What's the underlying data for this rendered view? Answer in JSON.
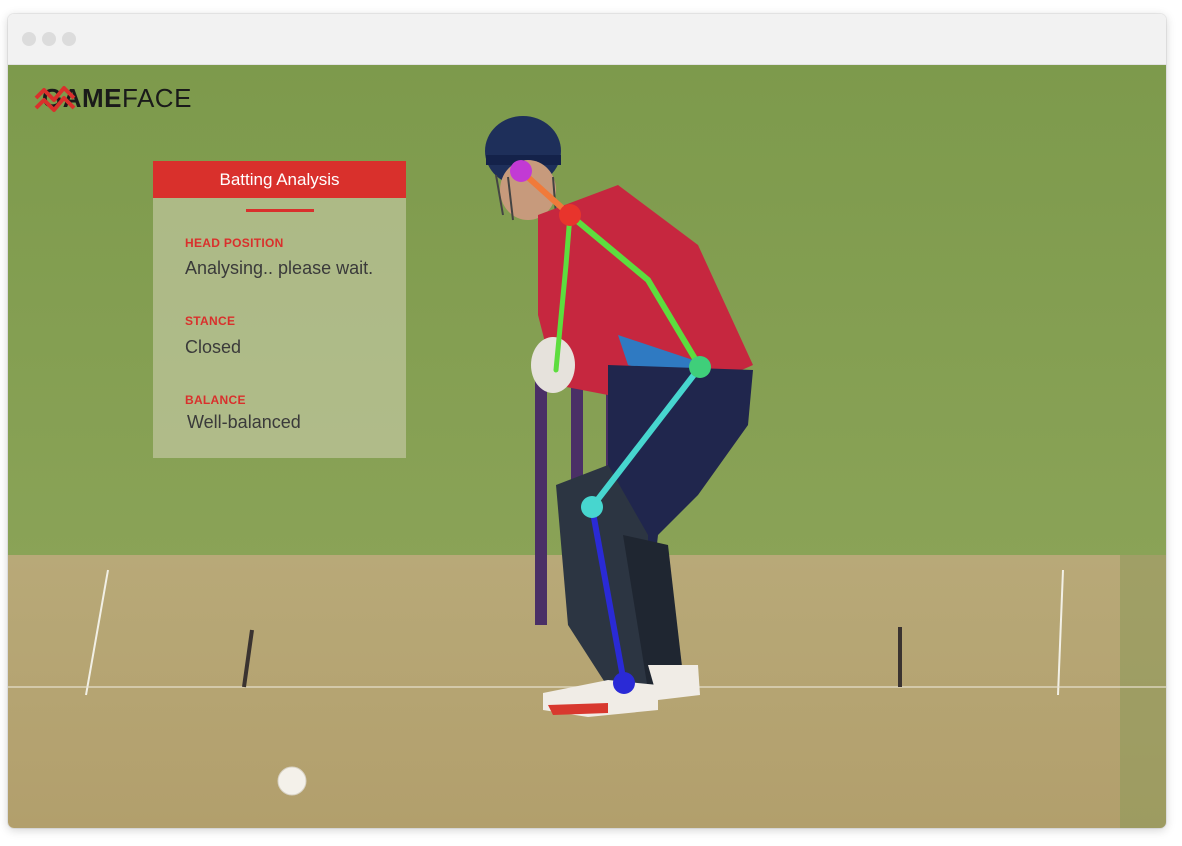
{
  "brand": {
    "logo_part1": "GAME",
    "logo_part2": "FACE",
    "accent": "#d9302c"
  },
  "panel": {
    "title": "Batting Analysis",
    "fields": [
      {
        "label": "HEAD POSITION",
        "value": "Analysing.. please wait."
      },
      {
        "label": "STANCE",
        "value": "Closed"
      },
      {
        "label": "BALANCE",
        "value": "Well-balanced"
      }
    ]
  },
  "pose_colors": {
    "head": "#c23ad4",
    "neck": "#e8342c",
    "arm": "#5ddd3e",
    "back": "#5ddd3e",
    "hip": "#3fcf7a",
    "thigh": "#47d6cf",
    "knee": "#47d6cf",
    "shin": "#2a2ad6",
    "ankle": "#2a2ad6",
    "neck_link": "#f07a3a"
  }
}
